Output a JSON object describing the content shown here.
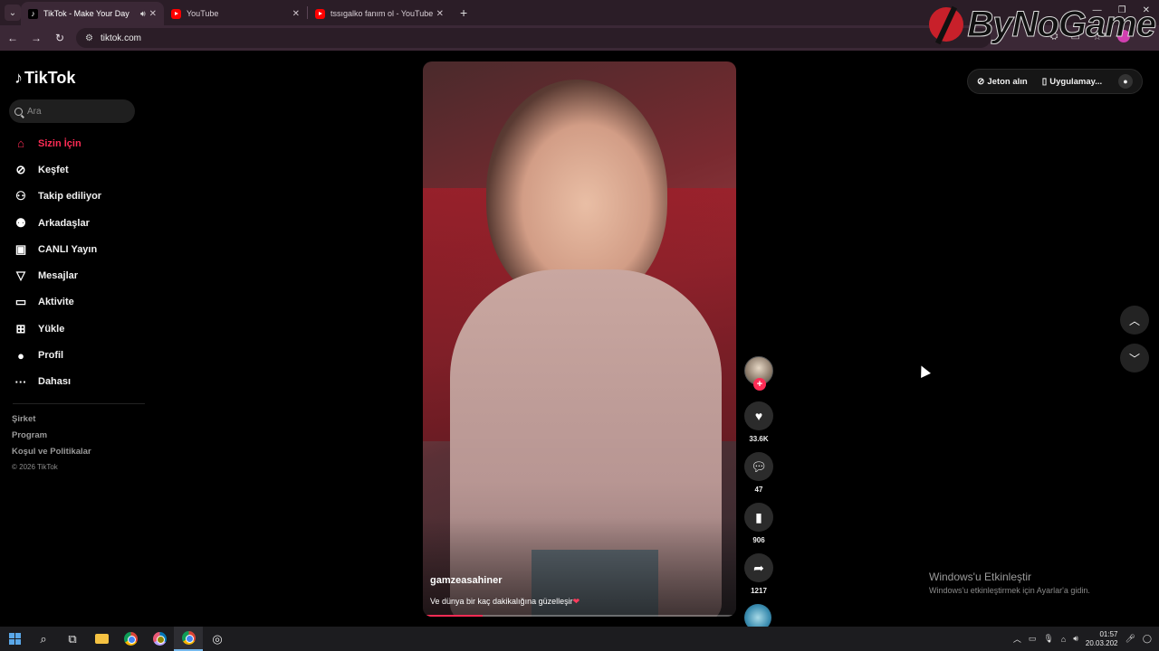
{
  "browser": {
    "tabs": [
      {
        "title": "TikTok - Make Your Day",
        "favicon": "tiktok-icon",
        "active": true,
        "audio": true
      },
      {
        "title": "YouTube",
        "favicon": "youtube-icon",
        "active": false
      },
      {
        "title": "tssıgalko fanım ol - YouTube",
        "favicon": "youtube-icon",
        "active": false
      }
    ],
    "url": "tiktok.com"
  },
  "watermark": {
    "text": "ByNoGame"
  },
  "sidebar": {
    "logo_text": "TikTok",
    "search_placeholder": "Ara",
    "items": [
      {
        "label": "Sizin İçin",
        "icon": "home-icon",
        "active": true
      },
      {
        "label": "Keşfet",
        "icon": "compass-icon"
      },
      {
        "label": "Takip ediliyor",
        "icon": "following-icon"
      },
      {
        "label": "Arkadaşlar",
        "icon": "friends-icon"
      },
      {
        "label": "CANLI Yayın",
        "icon": "live-icon"
      },
      {
        "label": "Mesajlar",
        "icon": "send-icon"
      },
      {
        "label": "Aktivite",
        "icon": "activity-icon"
      },
      {
        "label": "Yükle",
        "icon": "upload-icon"
      },
      {
        "label": "Profil",
        "icon": "profile-icon"
      },
      {
        "label": "Dahası",
        "icon": "more-icon"
      }
    ],
    "footer": [
      "Şirket",
      "Program",
      "Koşul ve Politikalar"
    ],
    "copyright": "© 2026 TikTok"
  },
  "video": {
    "author": "gamzeasahiner",
    "caption": "Ve dünya bir kaç dakikalığına güzelleşir",
    "progress": 0.19
  },
  "actions": {
    "likes": "33.6K",
    "comments": "47",
    "saves": "906",
    "shares": "1217"
  },
  "topright": {
    "coins_label": "Jeton alın",
    "app_label": "Uygulamay..."
  },
  "activation": {
    "title": "Windows'u Etkinleştir",
    "subtitle": "Windows'u etkinleştirmek için Ayarlar'a gidin."
  },
  "taskbar": {
    "time": "01:57",
    "date": "20.03.202"
  }
}
